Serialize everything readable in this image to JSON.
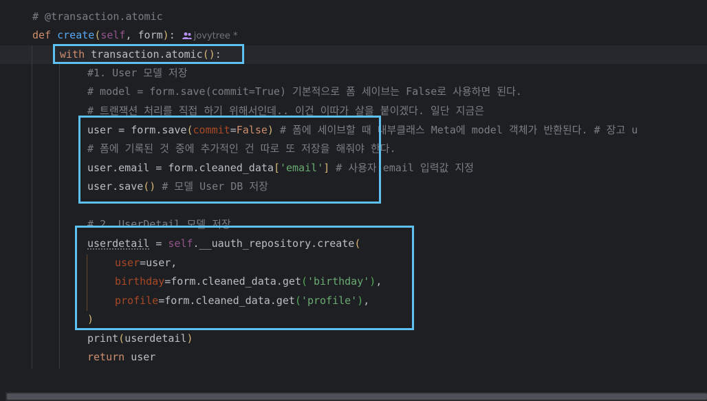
{
  "editor": {
    "lines": {
      "l1_comment": "# @transaction.atomic",
      "l2_def": "def",
      "l2_name": "create",
      "l2_self": "self",
      "l2_form": "form",
      "l2_author": "jovytree *",
      "l3_with": "with",
      "l3_call": "transaction.atomic",
      "l4_comment": "#1. User 모델 저장",
      "l5_comment": "# model = form.save(commit=True) 기본적으로 폼 세이브는 False로 사용하면 된다.",
      "l6_comment": "# 트랜잭션 처리를 직접 하기 위해서인데.. 이건 이따가 살을 붙이겠다. 일단 지금은",
      "l7_var": "user",
      "l7_call": "form.save",
      "l7_kw": "commit",
      "l7_val": "False",
      "l7_comment": "# 폼에 세이브할 때 내부클래스 Meta에 model 객체가 반환된다. # 장고 u",
      "l8_comment": "# 폼에 기록된 것 중에 추가적인 건 따로 또 저장을 해줘야 한다.",
      "l9_lhs": "user.email",
      "l9_call": "form.cleaned_data",
      "l9_key": "'email'",
      "l9_comment": "# 사용자 email 입력값 지정",
      "l10_call": "user.save",
      "l10_comment": "# 모델 User DB 저장",
      "l12_comment": "# 2. UserDetail 모델 저장",
      "l13_var": "userdetail",
      "l13_self": "self",
      "l13_call": ".__uauth_repository.create",
      "l14_kw": "user",
      "l14_val": "user,",
      "l15_kw": "birthday",
      "l15_call": "form.cleaned_data.get",
      "l15_str": "'birthday'",
      "l16_kw": "profile",
      "l16_call": "form.cleaned_data.get",
      "l16_str": "'profile'",
      "l18_print": "print",
      "l18_arg": "userdetail",
      "l19_return": "return",
      "l19_val": "user"
    }
  },
  "colors": {
    "background": "#1e1f22",
    "keyword": "#cf8e6d",
    "function": "#56a8f5",
    "string": "#6aab73",
    "comment": "#7a7e85",
    "self": "#94558d",
    "highlight_box": "#5ec1f2"
  },
  "icons": {
    "author": "people-icon"
  }
}
